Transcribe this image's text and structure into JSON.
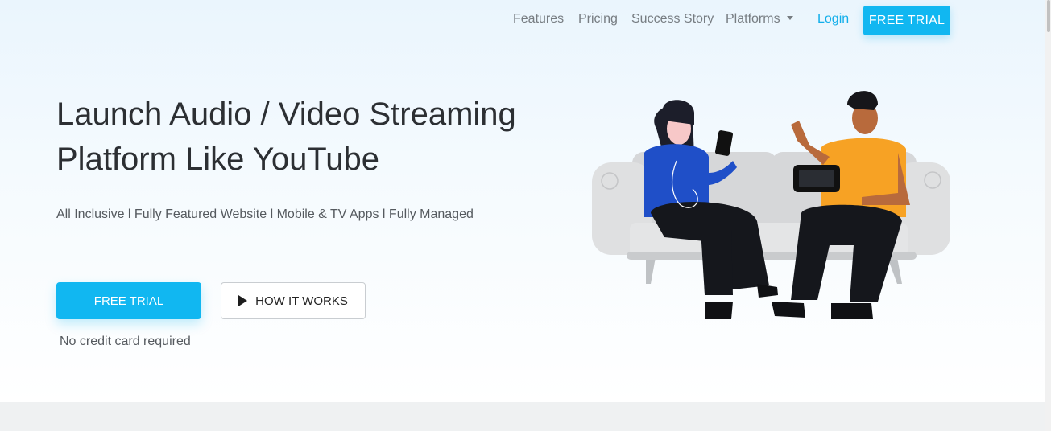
{
  "nav": {
    "links": [
      {
        "label": "Features"
      },
      {
        "label": "Pricing"
      },
      {
        "label": "Success Story"
      },
      {
        "label": "Platforms"
      }
    ],
    "login_label": "Login",
    "trial_label": "FREE TRIAL"
  },
  "hero": {
    "headline_line1": "Launch Audio / Video Streaming",
    "headline_line2": "Platform Like YouTube",
    "subline": "All Inclusive l Fully Featured Website l Mobile & TV Apps l Fully Managed",
    "primary_cta": "FREE TRIAL",
    "secondary_cta": "HOW IT WORKS",
    "note": "No credit card required"
  },
  "colors": {
    "accent": "#11b7f1",
    "link": "#11aeea",
    "text_dark": "#2c2f33",
    "text_muted": "#777d82"
  },
  "icons": {
    "play": "play-icon",
    "dropdown": "caret-down-icon"
  }
}
